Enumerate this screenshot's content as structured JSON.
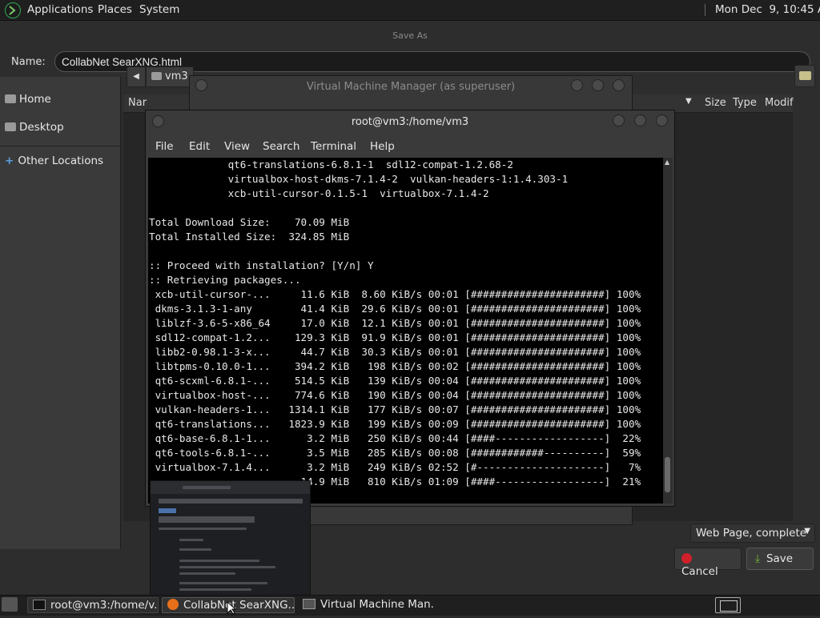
{
  "top_panel": {
    "menus": [
      "Applications",
      "Places",
      "System"
    ],
    "clock": "Mon Dec  9, 10:45 AM"
  },
  "save_dialog": {
    "title": "Save As",
    "name_label": "Name:",
    "name_value": "CollabNet SearXNG.html",
    "places": {
      "home": "Home",
      "desktop": "Desktop",
      "other": "Other Locations"
    },
    "path_segment": "vm3",
    "columns": {
      "name": "Nar",
      "size": "Size",
      "type": "Type",
      "modified": "Modif"
    },
    "filter": "Web Page, complete",
    "cancel": "Cancel",
    "save": "Save"
  },
  "vmm_window": {
    "title": "Virtual Machine Manager (as superuser)"
  },
  "terminal": {
    "title": "root@vm3:/home/vm3",
    "menus": [
      "File",
      "Edit",
      "View",
      "Search",
      "Terminal",
      "Help"
    ],
    "lines": [
      "             qt6-translations-6.8.1-1  sdl12-compat-1.2.68-2",
      "             virtualbox-host-dkms-7.1.4-2  vulkan-headers-1:1.4.303-1",
      "             xcb-util-cursor-0.1.5-1  virtualbox-7.1.4-2",
      "",
      "Total Download Size:    70.09 MiB",
      "Total Installed Size:  324.85 MiB",
      "",
      ":: Proceed with installation? [Y/n] Y",
      ":: Retrieving packages...",
      " xcb-util-cursor-...     11.6 KiB  8.60 KiB/s 00:01 [######################] 100%",
      " dkms-3.1.3-1-any        41.4 KiB  29.6 KiB/s 00:01 [######################] 100%",
      " liblzf-3.6-5-x86_64     17.0 KiB  12.1 KiB/s 00:01 [######################] 100%",
      " sdl12-compat-1.2...    129.3 KiB  91.9 KiB/s 00:01 [######################] 100%",
      " libb2-0.98.1-3-x...     44.7 KiB  30.3 KiB/s 00:01 [######################] 100%",
      " libtpms-0.10.0-1...    394.2 KiB   198 KiB/s 00:02 [######################] 100%",
      " qt6-scxml-6.8.1-...    514.5 KiB   139 KiB/s 00:04 [######################] 100%",
      " virtualbox-host-...    774.6 KiB   190 KiB/s 00:04 [######################] 100%",
      " vulkan-headers-1...   1314.1 KiB   177 KiB/s 00:07 [######################] 100%",
      " qt6-translations...   1823.9 KiB   199 KiB/s 00:09 [######################] 100%",
      " qt6-base-6.8.1-1...      3.2 MiB   250 KiB/s 00:44 [####------------------]  22%",
      " qt6-tools-6.8.1-...      3.5 MiB   285 KiB/s 00:08 [############----------]  59%",
      " virtualbox-7.1.4...      3.2 MiB   249 KiB/s 02:52 [#---------------------]   7%",
      "                         14.9 MiB   810 KiB/s 01:09 [####------------------]  21%"
    ]
  },
  "taskbar": {
    "tasks": [
      "root@vm3:/home/v...",
      "CollabNet SearXNG...",
      "Virtual Machine Man..."
    ]
  }
}
